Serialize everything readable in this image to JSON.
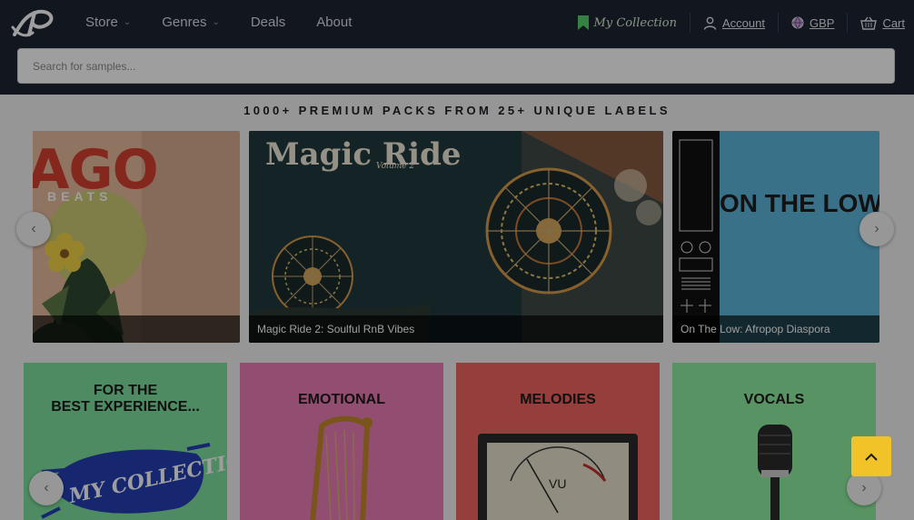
{
  "nav": {
    "menu": [
      {
        "label": "Store",
        "dropdown": true
      },
      {
        "label": "Genres",
        "dropdown": true
      },
      {
        "label": "Deals",
        "dropdown": false
      },
      {
        "label": "About",
        "dropdown": false
      }
    ],
    "collection_label": "My Collection",
    "account_label": "Account",
    "currency_label": "GBP",
    "cart_label": "Cart"
  },
  "search": {
    "placeholder": "Search for samples..."
  },
  "headline": "1000+ PREMIUM PACKS FROM 25+ UNIQUE LABELS",
  "carousel": {
    "items": [
      {
        "cover_title": "AGO",
        "cover_subtitle": "BEATS",
        "caption": ""
      },
      {
        "cover_title": "Magic Ride",
        "cover_subtitle": "Volume 2",
        "caption": "Magic Ride 2: Soulful RnB Vibes"
      },
      {
        "cover_title": "ON THE LOW",
        "cover_subtitle": "",
        "caption": "On The Low: Afropop Diaspora"
      }
    ]
  },
  "categories": [
    {
      "label": "FOR THE BEST EXPERIENCE...",
      "line1": "FOR THE",
      "line2": "BEST EXPERIENCE...",
      "tag": "MY COLLECTION"
    },
    {
      "label": "EMOTIONAL"
    },
    {
      "label": "MELODIES",
      "meter": "VU"
    },
    {
      "label": "VOCALS"
    }
  ],
  "colors": {
    "nav_bg": "#1e2533",
    "accent": "#f2c229",
    "collection_green": "#56d16a"
  }
}
